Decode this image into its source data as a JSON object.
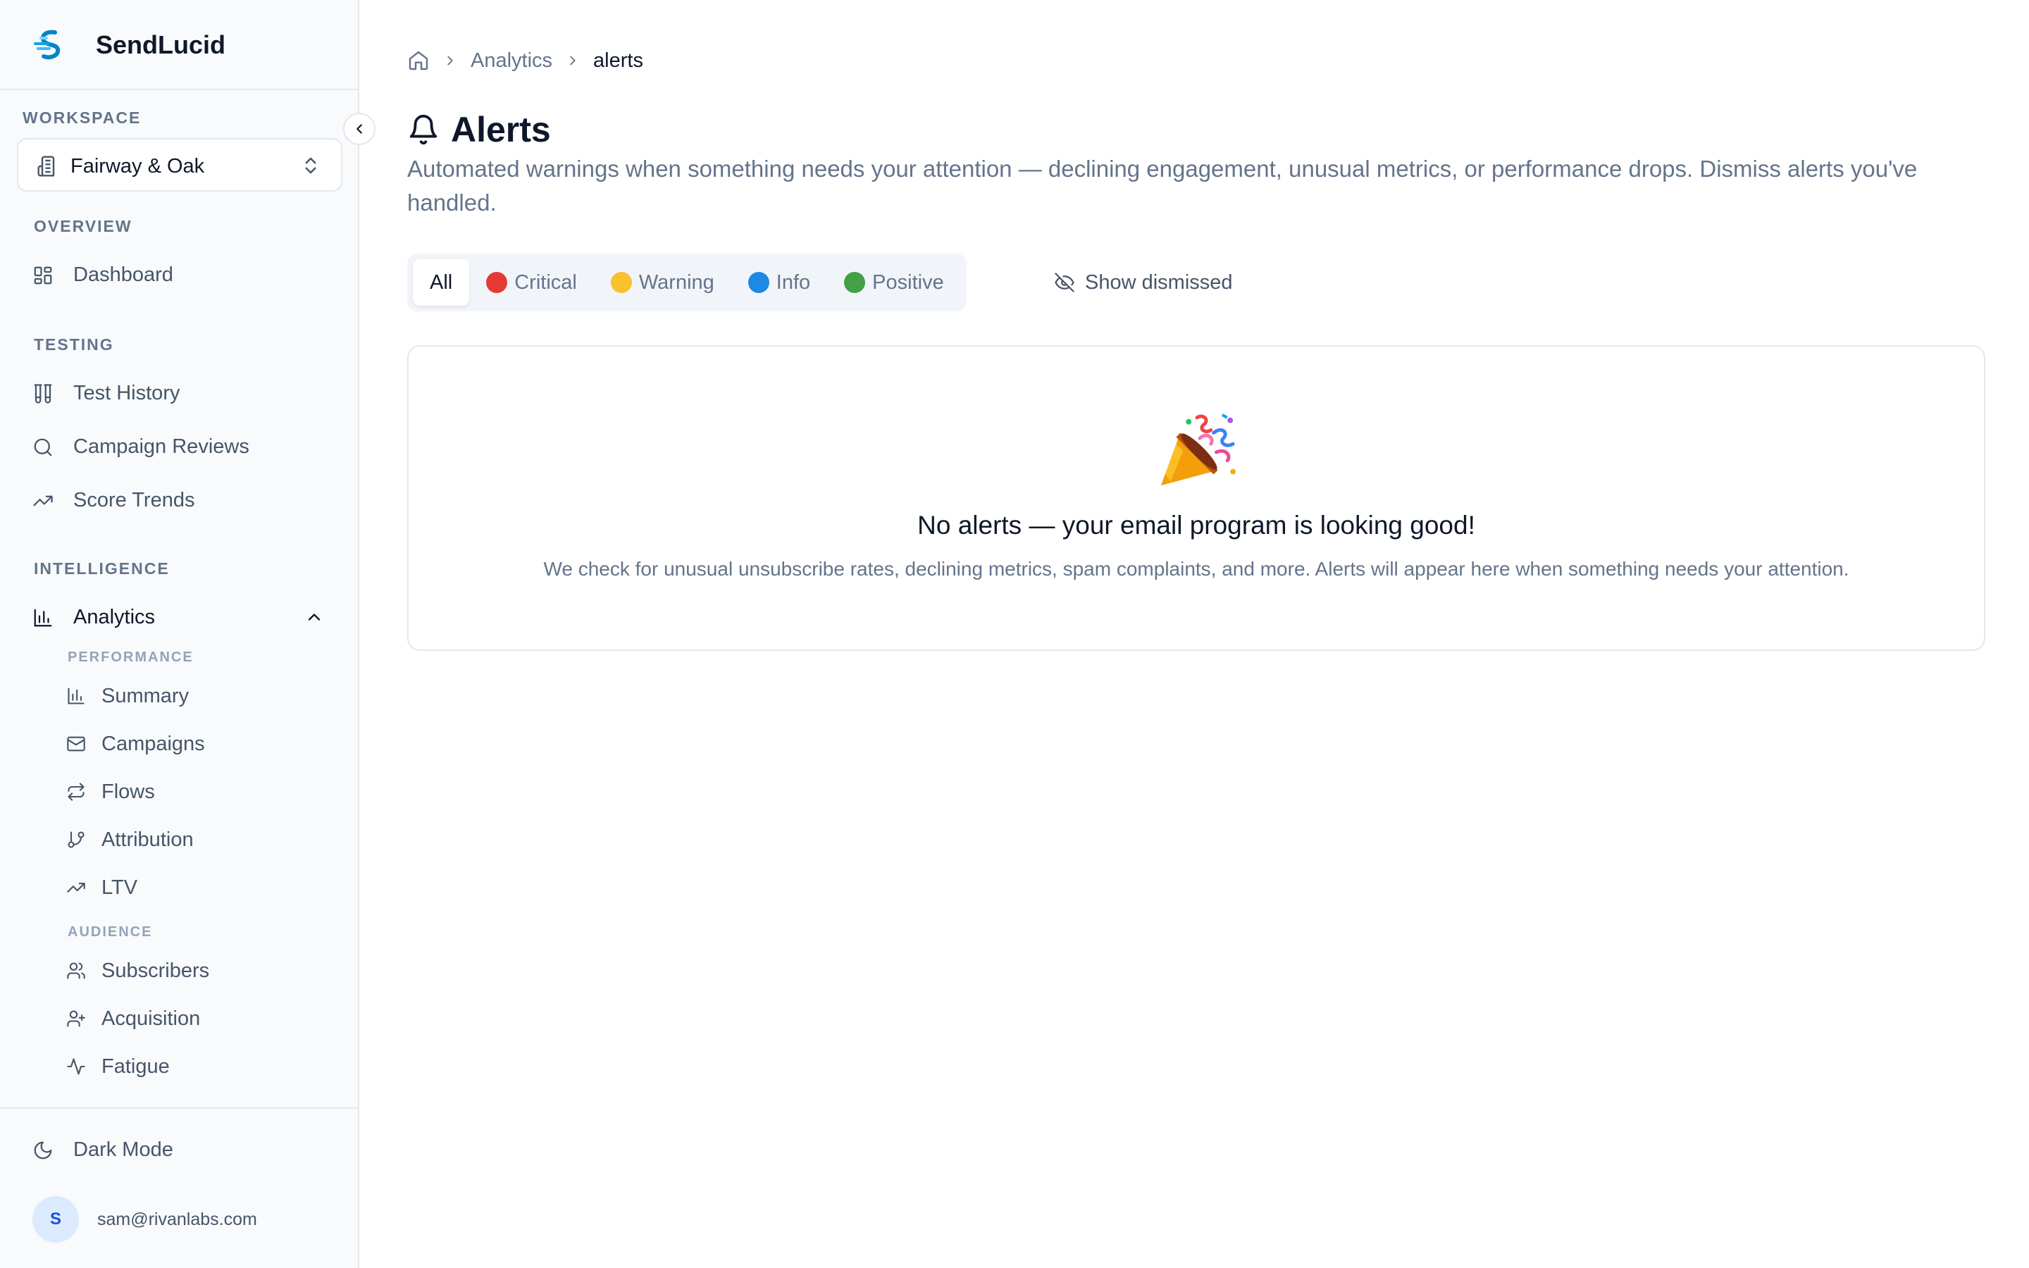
{
  "brand": {
    "name": "SendLucid"
  },
  "workspace": {
    "section_label": "WORKSPACE",
    "selected": "Fairway & Oak"
  },
  "sidebar": {
    "sections": {
      "overview": "OVERVIEW",
      "testing": "TESTING",
      "intelligence": "INTELLIGENCE"
    },
    "items": {
      "dashboard": "Dashboard",
      "test_history": "Test History",
      "campaign_reviews": "Campaign Reviews",
      "score_trends": "Score Trends",
      "analytics": "Analytics"
    },
    "analytics_sub": {
      "performance_label": "PERFORMANCE",
      "summary": "Summary",
      "campaigns": "Campaigns",
      "flows": "Flows",
      "attribution": "Attribution",
      "ltv": "LTV",
      "audience_label": "AUDIENCE",
      "subscribers": "Subscribers",
      "acquisition": "Acquisition",
      "fatigue": "Fatigue"
    },
    "dark_mode": "Dark Mode",
    "user": {
      "initial": "S",
      "email": "sam@rivanlabs.com"
    }
  },
  "breadcrumb": {
    "parent": "Analytics",
    "current": "alerts"
  },
  "page": {
    "title": "Alerts",
    "subtitle": "Automated warnings when something needs your attention — declining engagement, unusual metrics, or performance drops. Dismiss alerts you've handled."
  },
  "filters": {
    "all": "All",
    "critical": "Critical",
    "warning": "Warning",
    "info": "Info",
    "positive": "Positive",
    "show_dismissed": "Show dismissed"
  },
  "colors": {
    "critical": "#e53935",
    "warning": "#fbc02d",
    "info": "#1e88e5",
    "positive": "#43a047",
    "brand": "#0ea5e9"
  },
  "empty_state": {
    "title": "No alerts — your email program is looking good!",
    "description": "We check for unusual unsubscribe rates, declining metrics, spam complaints, and more. Alerts will appear here when something needs your attention."
  }
}
